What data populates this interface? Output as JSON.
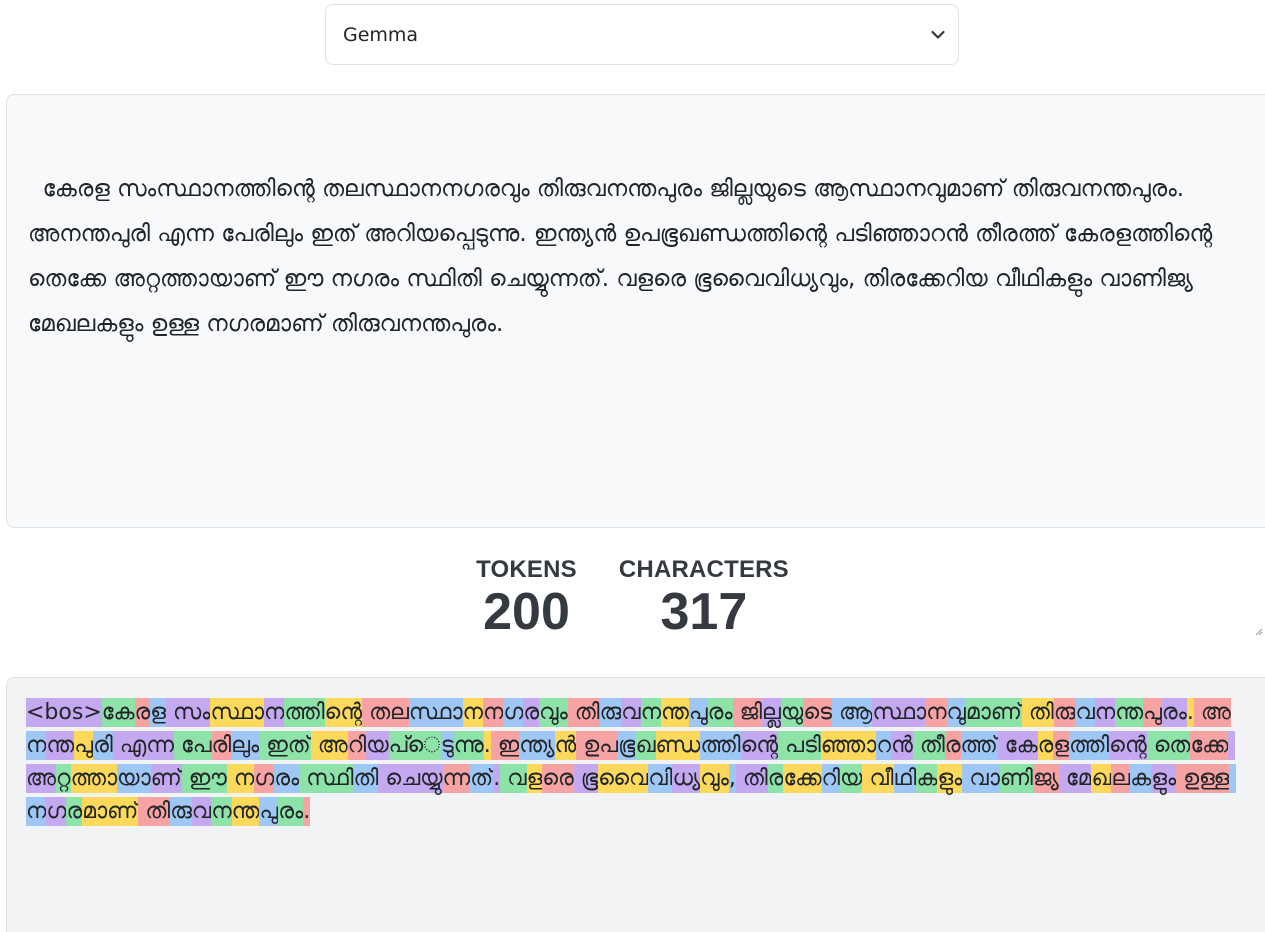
{
  "model_select": {
    "value": "Gemma"
  },
  "input_text": "കേരള സംസ്ഥാനത്തിന്റെ തലസ്ഥാനനഗരവും തിരുവനന്തപുരം ജില്ലയുടെ ആസ്ഥാനവുമാണ് തിരുവനന്തപുരം. അനന്തപുരി എന്ന പേരിലും ഇത് അറിയപ്പെടുന്നു. ഇന്ത്യൻ ഉപഭൂഖണ്ഡത്തിന്റെ പടിഞ്ഞാറൻ തീരത്ത് കേരളത്തിന്റെ തെക്കേ അറ്റത്തായാണ് ഈ നഗരം സ്ഥിതി ചെയ്യുന്നത്. വളരെ ഭൂവൈവിധ്യവും, തിരക്കേറിയ വീഥികളും വാണിജ്യ മേഖലകളും ഉള്ള നഗരമാണ് തിരുവനന്തപുരം.",
  "stats": {
    "tokens_label": "TOKENS",
    "tokens_value": "200",
    "characters_label": "CHARACTERS",
    "characters_value": "317"
  },
  "token_colors": [
    "#c4a8f0",
    "#8ee3a8",
    "#fcd95a",
    "#f8a3a3",
    "#9fc7f5"
  ],
  "tokens": [
    "<bos>",
    "ക",
    "േ",
    "ര",
    "ള",
    " സ",
    "ം",
    "സ്",
    "ഥ",
    "ാ",
    "ന",
    "ത്തി",
    "ന്റെ",
    " തല",
    "സ്",
    "ഥ",
    "ാ",
    "ന",
    "ന",
    "ഗ",
    "ര",
    "വ",
    "ും",
    " തി",
    "രു",
    "വ",
    "ന",
    "ന്",
    "ത",
    "പ",
    "ു",
    "ര",
    "ം",
    " ജ",
    "ി",
    "ല്ല",
    "യ",
    "ു",
    "ടെ",
    " ആ",
    "സ്",
    "ഥ",
    "ാ",
    "ന",
    "വ",
    "ു",
    "മാണ്",
    " തി",
    "രു",
    "വ",
    "ന",
    "ന്",
    "ത",
    "പ",
    "ു",
    "ര",
    "ം",
    ".",
    " അ",
    "ന",
    "ന്",
    "ത",
    "പ",
    "ു",
    "രി",
    " എന്ന",
    " പ",
    "േ",
    "രി",
    "ല",
    "ും",
    " ഇത്",
    " അ",
    "റ",
    "ി",
    "യ",
    "പ",
    "്",
    "െ",
    "ട",
    "ു",
    "ന്നു",
    ".",
    " ഇ",
    "ന്",
    "ത്",
    "യ",
    "ൻ",
    " ഉപ",
    "ഭ",
    "ൂ",
    "ഖ",
    "ണ്",
    "ഡ",
    "ത്തി",
    "ന്റെ",
    " പടി",
    "ഞ്ഞ",
    "ാ",
    "റ",
    "ൻ",
    " ത",
    "ീ",
    "ര",
    "ത്ത്",
    " ക",
    "േ",
    "ര",
    "ള",
    "ത്തി",
    "ന്റെ",
    " ത",
    "െ",
    "ക്ക",
    "േ",
    " അ",
    "റ്റ",
    "ത്ത",
    "ാ",
    "യ",
    "ാണ്",
    " ഈ",
    " ന",
    "ഗ",
    "ര",
    "ം",
    " സ്",
    "ഥ",
    "ി",
    "തി",
    " ചെയ",
    "്യ",
    "ു",
    "ന്ന",
    "ത്",
    ".",
    " വ",
    "ള",
    "ര",
    "െ",
    " ഭ",
    "ൂ",
    "വ",
    "ൈ",
    "വി",
    "ധ",
    "്യ",
    "വ",
    "ും",
    ",",
    " തി",
    "ര",
    "ക്ക",
    "േ",
    "റ",
    "ി",
    "യ",
    " വ",
    "ീ",
    "ഥ",
    "ി",
    "ക",
    "ള",
    "ും",
    " വ",
    "ാ",
    "ണ",
    "ി",
    "ജ",
    "്യ",
    " മ",
    "േ",
    "ഖ",
    "ല",
    "ക",
    "ള",
    "ു",
    "ം",
    " ഉള്ള",
    " ന",
    "ഗ",
    "ര",
    "മാണ്",
    " തി",
    "രു",
    "വ",
    "ന",
    "ന്",
    "ത",
    "പ",
    "ു",
    "ര",
    "ം",
    "."
  ]
}
